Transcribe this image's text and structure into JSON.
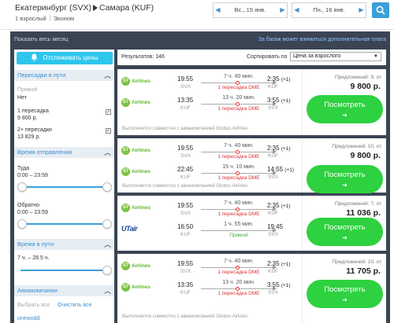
{
  "header": {
    "origin": "Екатеринбург (SVX)",
    "destination": "Самара (KUF)",
    "passengers": "1 взрослый",
    "cabin": "Эконом",
    "depart_date": "Вс., 15 янв.",
    "return_date": "Пн., 16 янв."
  },
  "topline": {
    "show_month": "Показать весь месяц",
    "baggage_note": "За багаж может взиматься дополнительная плата"
  },
  "sidebar": {
    "track_label": "Отслеживать цены",
    "stops_title": "Пересадки в пути",
    "direct_label": "Прямой",
    "direct_value": "Нет",
    "one_stop_label": "1 пересадка",
    "one_stop_price": "9 800 р.",
    "two_stop_label": "2+ пересадки",
    "two_stop_price": "13 829 р.",
    "dep_time_title": "Время отправления",
    "there_label": "Туда",
    "there_range": "0:00 – 23:59",
    "back_label": "Обратно",
    "back_range": "0:00 – 23:59",
    "travel_time_title": "Время в пути",
    "travel_range": "7 ч. – 28.5 ч.",
    "airlines_title": "Авиакомпании",
    "select_all": "Выбрать все",
    "clear_all": "Очистить все",
    "airline_first": "onewodd"
  },
  "results": {
    "count_label": "Результатов: 146",
    "sort_label": "Сортировать по",
    "sort_value": "Цена за взрослого"
  },
  "cards": [
    {
      "offers": "Предложений: 9, от",
      "price": "9 800 р.",
      "button": "Посмотреть",
      "arrow": "➜",
      "joint": "Выполняется совместно с авиакомпанией Globus Airlines",
      "segments": [
        {
          "airline": "Airlines",
          "logo": "S7",
          "dep": "19:55",
          "dep_code": "SVX",
          "duration": "7 ч. 40 мин.",
          "stops": "1 пересадка DME",
          "arr": "2:35",
          "plus": "(+1)",
          "arr_code": "KUF"
        },
        {
          "airline": "Airlines",
          "logo": "S7",
          "dep": "13:35",
          "dep_code": "KUF",
          "duration": "13 ч. 20 мин.",
          "stops": "1 пересадка DME",
          "arr": "3:55",
          "plus": "(+1)",
          "arr_code": "SVX"
        }
      ]
    },
    {
      "offers": "Предложений: 10, от",
      "price": "9 800 р.",
      "button": "Посмотреть",
      "arrow": "➜",
      "joint": "Выполняется совместно с авиакомпанией Globus Airlines",
      "segments": [
        {
          "airline": "Airlines",
          "logo": "S7",
          "dep": "19:55",
          "dep_code": "SVX",
          "duration": "7 ч. 40 мин.",
          "stops": "1 пересадка DME",
          "arr": "2:35",
          "plus": "(+1)",
          "arr_code": "KUF"
        },
        {
          "airline": "Airlines",
          "logo": "S7",
          "dep": "22:45",
          "dep_code": "KUF",
          "duration": "15 ч. 10 мин.",
          "stops": "1 пересадка DME",
          "arr": "14:55",
          "plus": "(+1)",
          "arr_code": "SVX"
        }
      ]
    },
    {
      "offers": "Предложений: 7, от",
      "price": "11 036 р.",
      "button": "Посмотреть",
      "arrow": "➜",
      "joint": "",
      "segments": [
        {
          "airline": "Airlines",
          "logo": "S7",
          "dep": "19:55",
          "dep_code": "SVX",
          "duration": "7 ч. 40 мин.",
          "stops": "1 пересадка DME",
          "arr": "2:35",
          "plus": "(+1)",
          "arr_code": "KUF"
        },
        {
          "airline": "UTair",
          "logo": "",
          "dep": "16:50",
          "dep_code": "KUF",
          "duration": "1 ч. 55 мин.",
          "stops": "Прямой",
          "arr": "19:45",
          "plus": "",
          "arr_code": "SVX"
        }
      ]
    },
    {
      "offers": "Предложений: 10, от",
      "price": "11 705 р.",
      "button": "Посмотреть",
      "arrow": "➜",
      "joint": "Выполняется совместно с авиакомпанией Globus Airlines",
      "segments": [
        {
          "airline": "Airlines",
          "logo": "S7",
          "dep": "19:55",
          "dep_code": "SVX",
          "duration": "7 ч. 40 мин.",
          "stops": "1 пересадка DME",
          "arr": "2:35",
          "plus": "(+1)",
          "arr_code": "KUF"
        },
        {
          "airline": "Airlines",
          "logo": "S7",
          "dep": "13:35",
          "dep_code": "KUF",
          "duration": "13 ч. 20 мин.",
          "stops": "1 пересадка DME",
          "arr": "3:55",
          "plus": "(+1)",
          "arr_code": "SVX"
        }
      ]
    }
  ]
}
